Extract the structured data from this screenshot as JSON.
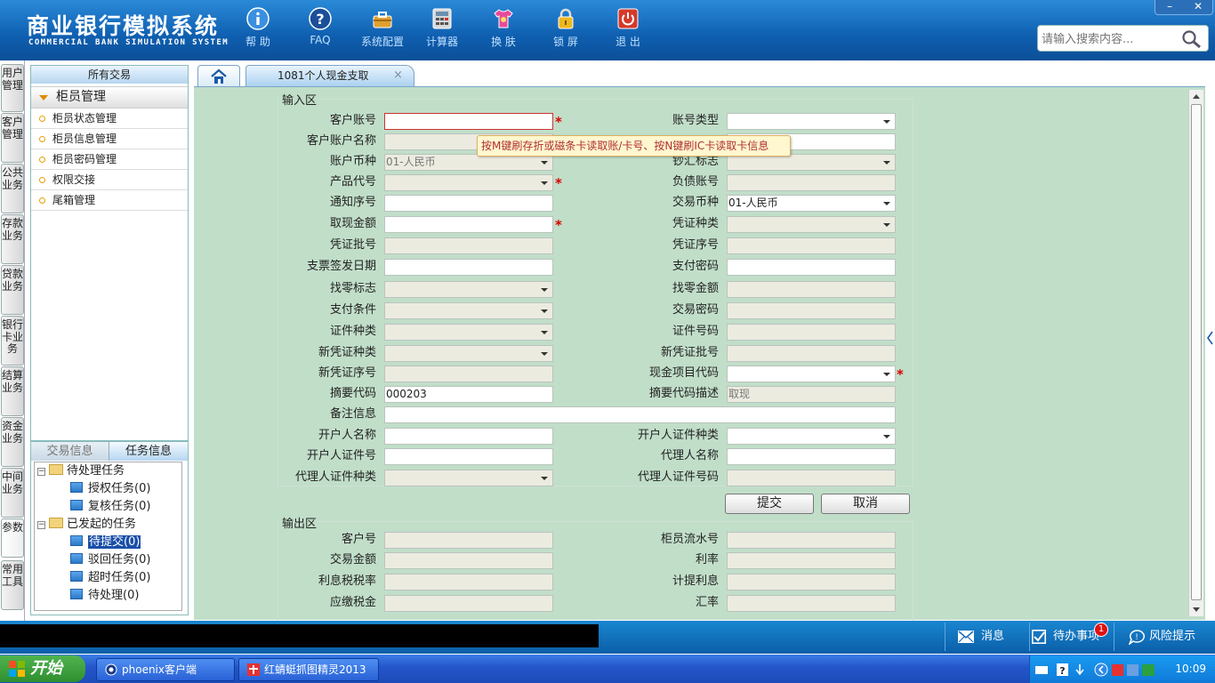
{
  "header": {
    "title_cn": "商业银行模拟系统",
    "title_en": "COMMERCIAL BANK SIMULATION SYSTEM",
    "toolbar": [
      {
        "label": "帮 助",
        "icon": "info-icon"
      },
      {
        "label": "FAQ",
        "icon": "question-icon"
      },
      {
        "label": "系统配置",
        "icon": "toolbox-icon"
      },
      {
        "label": "计算器",
        "icon": "calculator-icon"
      },
      {
        "label": "换 肤",
        "icon": "shirt-icon"
      },
      {
        "label": "锁 屏",
        "icon": "lock-icon"
      },
      {
        "label": "退 出",
        "icon": "power-icon"
      }
    ],
    "search_placeholder": "请输入搜索内容...",
    "window_buttons": [
      "–",
      "✕"
    ]
  },
  "vertical_tabs": [
    "用户管理",
    "客户管理",
    "公共业务",
    "存款业务",
    "贷款业务",
    "银行卡业务",
    "结算业务",
    "资金业务",
    "中间业务",
    "参数",
    "常用工具"
  ],
  "left_panel": {
    "title": "所有交易",
    "group": "柜员管理",
    "items": [
      "柜员状态管理",
      "柜员信息管理",
      "柜员密码管理",
      "权限交接",
      "尾箱管理"
    ]
  },
  "task_panel": {
    "tabs": [
      "交易信息",
      "任务信息"
    ],
    "pending_root": "待处理任务",
    "pending_children": [
      "授权任务(0)",
      "复核任务(0)"
    ],
    "initiated_root": "已发起的任务",
    "initiated_children": [
      "待提交(0)",
      "驳回任务(0)",
      "超时任务(0)",
      "待处理(0)"
    ]
  },
  "tabs": {
    "active": "1081个人现金支取",
    "close": "×"
  },
  "input_section": {
    "title": "输入区",
    "tooltip": "按M键刷存折或磁条卡读取账/卡号、按N键刷IC卡读取卡信息",
    "fields": {
      "customer_account": {
        "label": "客户账号",
        "value": ""
      },
      "account_type": {
        "label": "账号类型",
        "value": ""
      },
      "customer_account_name": {
        "label": "客户账户名称",
        "value": ""
      },
      "account_currency": {
        "label": "账户币种",
        "value": "01-人民币"
      },
      "cash_flag": {
        "label": "钞汇标志",
        "value": ""
      },
      "product_code": {
        "label": "产品代号",
        "value": ""
      },
      "liability_account": {
        "label": "负债账号",
        "value": ""
      },
      "notice_no": {
        "label": "通知序号",
        "value": ""
      },
      "trade_currency": {
        "label": "交易币种",
        "value": "01-人民币"
      },
      "withdraw_amount": {
        "label": "取现金额",
        "value": ""
      },
      "voucher_type": {
        "label": "凭证种类",
        "value": ""
      },
      "voucher_batch": {
        "label": "凭证批号",
        "value": ""
      },
      "voucher_seq": {
        "label": "凭证序号",
        "value": ""
      },
      "check_date": {
        "label": "支票签发日期",
        "value": ""
      },
      "pay_password": {
        "label": "支付密码",
        "value": ""
      },
      "change_flag": {
        "label": "找零标志",
        "value": ""
      },
      "change_amount": {
        "label": "找零金额",
        "value": ""
      },
      "pay_condition": {
        "label": "支付条件",
        "value": ""
      },
      "trade_password": {
        "label": "交易密码",
        "value": ""
      },
      "id_type": {
        "label": "证件种类",
        "value": ""
      },
      "id_no": {
        "label": "证件号码",
        "value": ""
      },
      "new_voucher_type": {
        "label": "新凭证种类",
        "value": ""
      },
      "new_voucher_batch": {
        "label": "新凭证批号",
        "value": ""
      },
      "new_voucher_seq": {
        "label": "新凭证序号",
        "value": ""
      },
      "cash_item_code": {
        "label": "现金项目代码",
        "value": ""
      },
      "summary_code": {
        "label": "摘要代码",
        "value": "000203"
      },
      "summary_desc": {
        "label": "摘要代码描述",
        "value": "取现"
      },
      "remarks": {
        "label": "备注信息",
        "value": ""
      },
      "opener_name": {
        "label": "开户人名称",
        "value": ""
      },
      "opener_id_type": {
        "label": "开户人证件种类",
        "value": ""
      },
      "opener_id_no": {
        "label": "开户人证件号",
        "value": ""
      },
      "agent_name": {
        "label": "代理人名称",
        "value": ""
      },
      "agent_id_type": {
        "label": "代理人证件种类",
        "value": ""
      },
      "agent_id_no": {
        "label": "代理人证件号码",
        "value": ""
      }
    },
    "submit_label": "提交",
    "cancel_label": "取消",
    "required_mark": "*"
  },
  "output_section": {
    "title": "输出区",
    "fields": {
      "customer_no": {
        "label": "客户号",
        "value": ""
      },
      "teller_serial": {
        "label": "柜员流水号",
        "value": ""
      },
      "trade_amount": {
        "label": "交易金额",
        "value": ""
      },
      "interest_rate": {
        "label": "利率",
        "value": ""
      },
      "interest_tax_rate": {
        "label": "利息税税率",
        "value": ""
      },
      "accrued_interest": {
        "label": "计提利息",
        "value": ""
      },
      "tax_payable": {
        "label": "应缴税金",
        "value": ""
      },
      "exchange_rate": {
        "label": "汇率",
        "value": ""
      }
    }
  },
  "statusbar": {
    "message": "消息",
    "todo": "待办事项",
    "todo_badge": "1",
    "risk": "风险提示"
  },
  "taskbar": {
    "start": "开始",
    "items": [
      "phoenix客户端",
      "红蜻蜓抓图精灵2013"
    ],
    "clock": "10:09"
  },
  "colors": {
    "header_blue": "#0f5fb0",
    "form_bg": "#c1dec9",
    "required_red": "#dd0000"
  }
}
